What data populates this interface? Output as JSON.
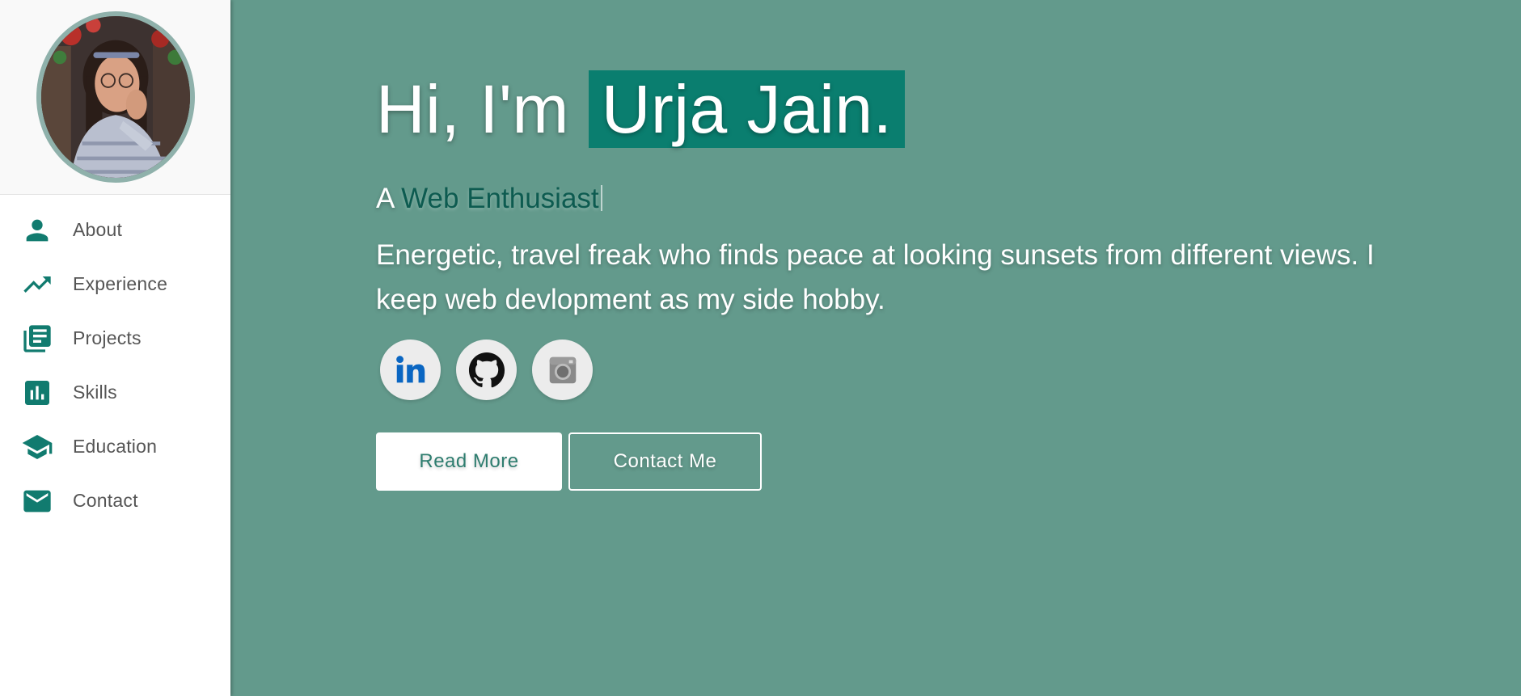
{
  "sidebar": {
    "avatar_alt": "Profile photo",
    "items": [
      {
        "label": "About",
        "icon": "person-icon"
      },
      {
        "label": "Experience",
        "icon": "trending-up-icon"
      },
      {
        "label": "Projects",
        "icon": "library-books-icon"
      },
      {
        "label": "Skills",
        "icon": "bar-chart-icon"
      },
      {
        "label": "Education",
        "icon": "graduation-cap-icon"
      },
      {
        "label": "Contact",
        "icon": "mail-icon"
      }
    ]
  },
  "hero": {
    "greeting": "Hi, I'm ",
    "name": "Urja Jain.",
    "subtitle_prefix": "A ",
    "role": "Web Enthusiast",
    "bio": "Energetic, travel freak who finds peace at looking sunsets from different views. I keep web devlopment as my side hobby."
  },
  "socials": [
    {
      "name": "linkedin",
      "icon": "linkedin-icon"
    },
    {
      "name": "github",
      "icon": "github-icon"
    },
    {
      "name": "instagram",
      "icon": "instagram-icon"
    }
  ],
  "buttons": {
    "read_more": "Read More",
    "contact_me": "Contact Me"
  },
  "colors": {
    "accent": "#117b6f",
    "main_bg": "#639a8c",
    "name_highlight": "#0a7e6f"
  }
}
